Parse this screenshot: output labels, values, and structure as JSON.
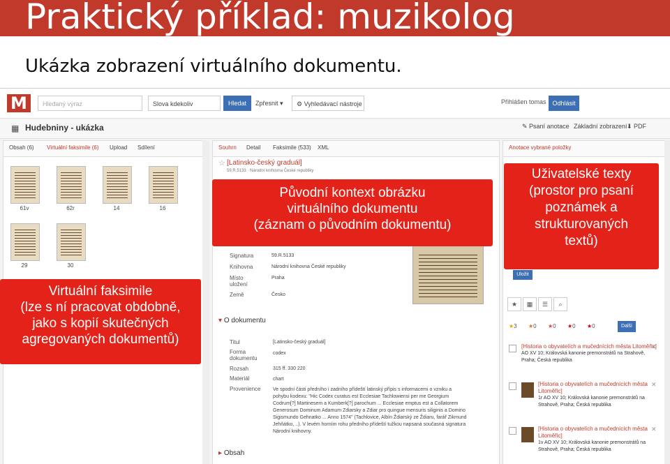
{
  "slide": {
    "title": "Praktický příklad: muzikolog",
    "subtitle": "Ukázka zobrazení virtuálního dokumentu."
  },
  "app": {
    "logo": "M",
    "search_placeholder": "Hledaný výraz",
    "search_scope": "Slova kdekoliv",
    "search_button": "Hledat",
    "refine_button": "Zpřesnit ▾",
    "tools_button": "Vyhledávací nástroje",
    "login_label": "Přihlášen tomas",
    "logout_button": "Odhlásit",
    "collection_title": "Hudebniny - ukázka",
    "actions": {
      "annotation": "Psaní anotace",
      "basic": "Základní zobrazení",
      "pdf": "PDF"
    }
  },
  "left_panel": {
    "tabs": [
      "Obsah (6)",
      "Virtuální faksimile (6)",
      "Upload",
      "Sdílení"
    ],
    "thumbnails": [
      "61v",
      "62r",
      "14",
      "16",
      "29",
      "30"
    ]
  },
  "mid_panel": {
    "tabs": [
      "Souhrn",
      "Detail",
      "Faksimile (533)",
      "XML"
    ],
    "record_title": "[Latinsko-český graduál]",
    "record_sub": "59.R.5133 · Národní knihovna České republiky",
    "fields": [
      {
        "label": "Signatura",
        "value": "59.R.5133"
      },
      {
        "label": "Knihovna",
        "value": "Národní knihovna České republiky"
      },
      {
        "label": "Místo uložení",
        "value": "Praha"
      },
      {
        "label": "Země",
        "value": "Česko"
      }
    ],
    "section_about": "O dokumentu",
    "about_fields": [
      {
        "label": "Titul",
        "value": "[Latinsko-český graduál]"
      },
      {
        "label": "Forma dokumentu",
        "value": "codex"
      },
      {
        "label": "Rozsah",
        "value": "315 ff. 330 220"
      },
      {
        "label": "Materiál",
        "value": "chart"
      }
    ],
    "provenience_label": "Provenience",
    "provenience_text": "Ve spodní části předního i zadního přídeští latinský přípis s informacemi o vzniku a pohybu kodexu: \"Hic Codex curatus est Ecclesiae Tachlowiensi per me Georgium Codrum[?] Martinesem a Kumberk[?] parochum ... Ecclesiae emptus est a Collatorem Generosum Dominum Adamum Zdiarsky a Zdiar pro quingue mensuris siliginis a Domino Sigismundo Gehnatko ... Anno 1574\" (Tachlovice, Albín Ždiarský ze Ždiaru, farář Zikmund Jehňátko, ..). V levém horním rohu předního přídeští tužkou napsaná současná signatura Národní knihovny.",
    "section_content": "Obsah"
  },
  "right_panel": {
    "tab": "Anotace vybrané položky",
    "save_button": "Uložit",
    "toolbar_icons": [
      "star-icon",
      "grid-icon",
      "list-icon",
      "search-icon"
    ],
    "ratings": [
      "3",
      "0",
      "0",
      "0",
      "0"
    ],
    "more_button": "Další",
    "results": [
      {
        "title": "[Historia o obyvatelích a mučednících města Litoměřic]",
        "desc": "AO XV 10; Královská kanonie premonstrátů na Strahově, Praha; Česká republika"
      },
      {
        "title": "[Historia o obyvatelích a mučednících města Litoměřic]",
        "desc": "1r AO XV 10; Královská kanonie premonstrátů na Strahově, Praha; Česká republika"
      },
      {
        "title": "[Historia o obyvatelích a mučednících města Litoměřic]",
        "desc": "1v AO XV 10; Královská kanonie premonstrátů na Strahově, Praha; Česká republika"
      }
    ]
  },
  "callouts": {
    "left": {
      "bold": "Virtuální faksimile",
      "lines": [
        "(lze s ní pracovat obdobně,",
        "jako s kopií skutečných",
        "agregovaných dokumentů)"
      ]
    },
    "mid": {
      "bold": "",
      "lines": [
        "Původní kontext obrázku",
        "virtuálního dokumentu",
        "(záznam o původním dokumentu)"
      ]
    },
    "right": {
      "bold": "Uživatelské texty",
      "lines": [
        "(prostor pro psaní",
        "poznámek a",
        "strukturovaných",
        "textů)"
      ]
    }
  },
  "colors": {
    "brand_red": "#c0392b",
    "callout_red": "#e32219",
    "button_blue": "#3d6fb6"
  }
}
